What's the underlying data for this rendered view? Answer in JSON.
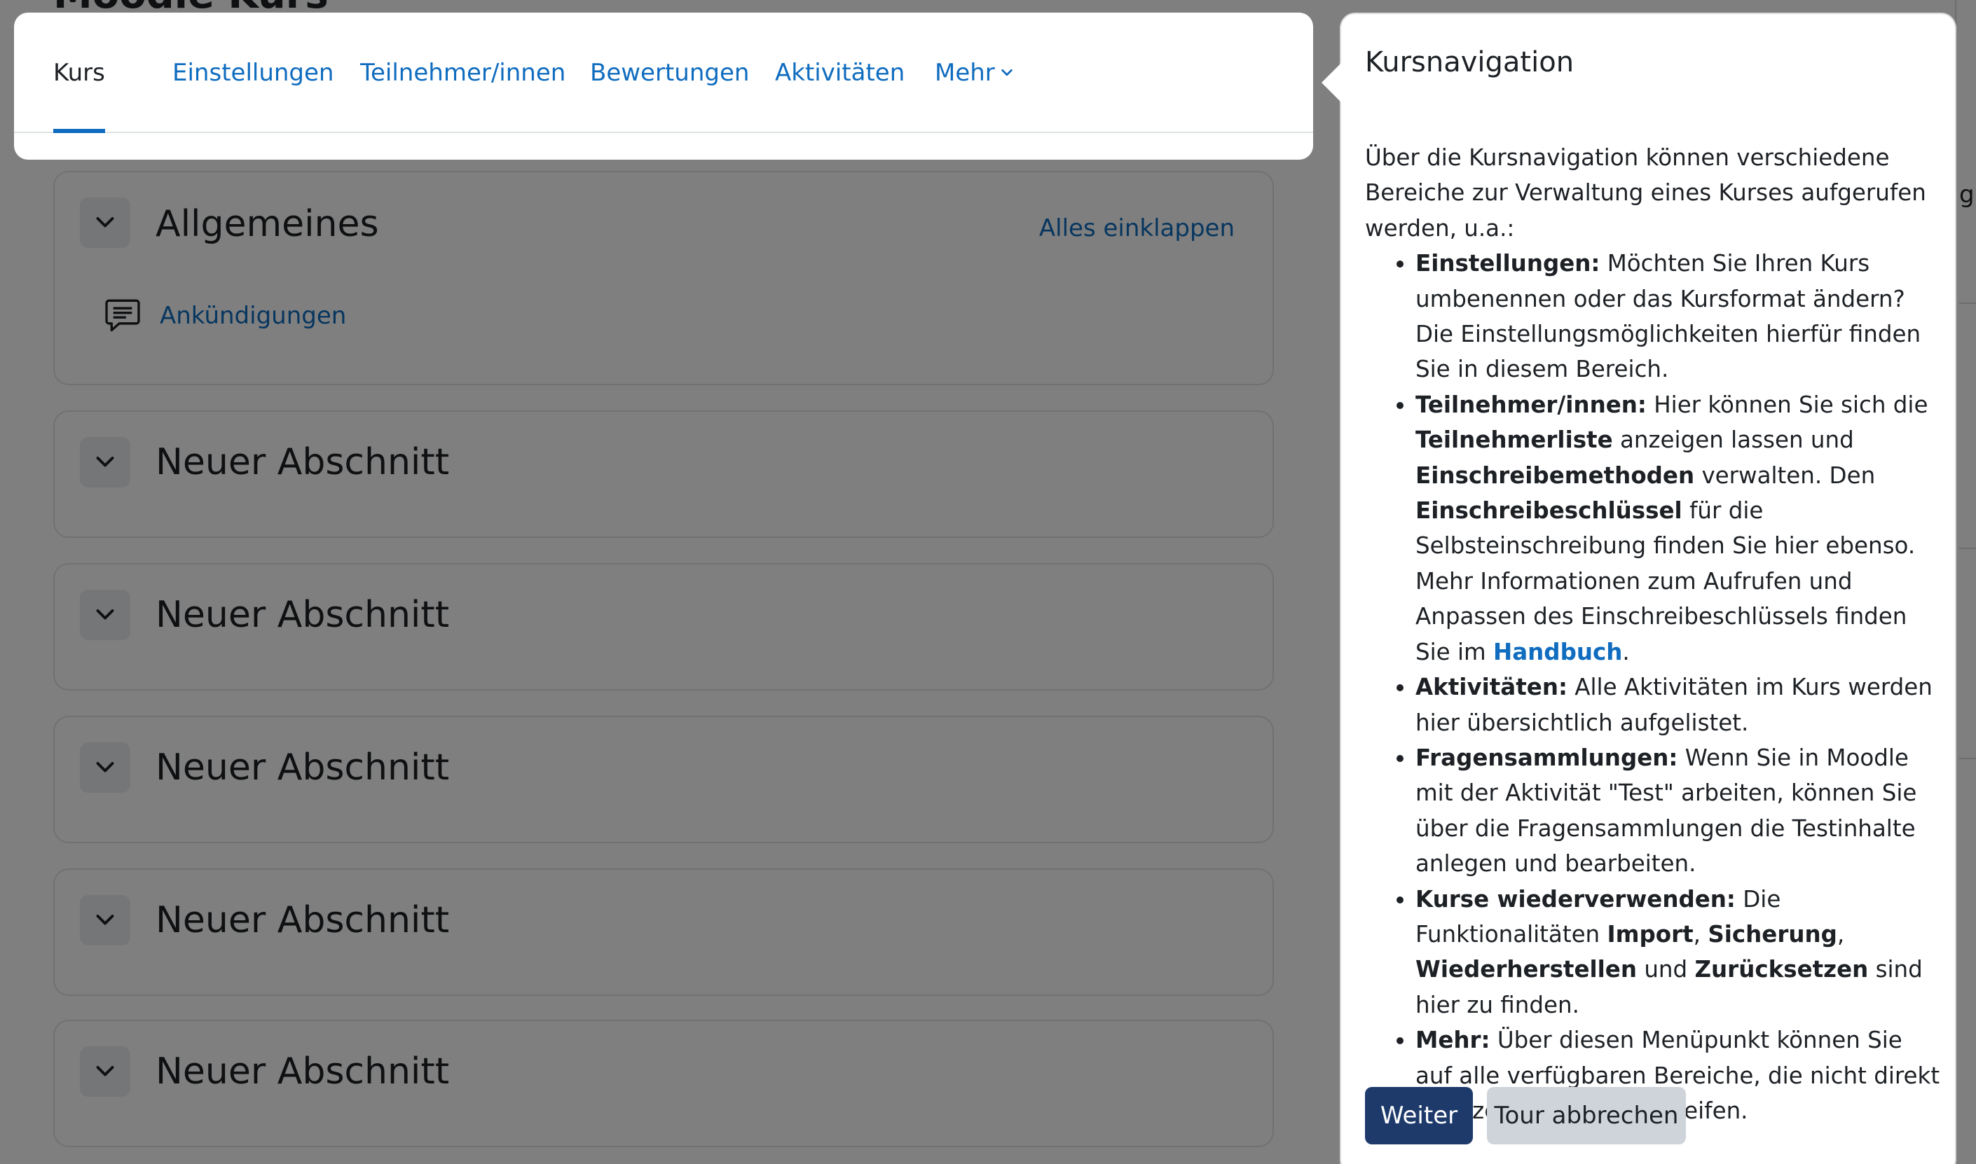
{
  "page": {
    "title": "Moodle Kurs"
  },
  "sections": [
    {
      "title": "Allgemeines",
      "collapse_all": "Alles einklappen",
      "activities": [
        {
          "label": "Ankündigungen",
          "icon": "forum-icon"
        }
      ]
    },
    {
      "title": "Neuer Abschnitt"
    },
    {
      "title": "Neuer Abschnitt"
    },
    {
      "title": "Neuer Abschnitt"
    },
    {
      "title": "Neuer Abschnitt"
    },
    {
      "title": "Neuer Abschnitt"
    }
  ],
  "secondary_nav": {
    "tabs": [
      "Kurs",
      "Einstellungen",
      "Teilnehmer/innen",
      "Bewertungen",
      "Aktivitäten",
      "Mehr"
    ],
    "active": "Kurs",
    "more_icon": "chevron-down-icon"
  },
  "tour": {
    "title": "Kursnavigation",
    "intro": "Über die Kursnavigation können verschiedene Bereiche zur Verwaltung eines Kurses aufgerufen werden, u.a.:",
    "items": [
      {
        "term": "Einstellungen:",
        "text": "Möchten Sie Ihren Kurs umbenennen oder das Kursformat ändern? Die Einstellungsmöglichkeiten hierfür finden Sie in diesem Bereich."
      },
      {
        "term": "Teilnehmer/innen:",
        "text_1": "Hier können Sie sich die",
        "bold_1": "Teilnehmerliste",
        "text_2": "anzeigen lassen und",
        "bold_2": "Einschreibemethoden",
        "text_3": "verwalten. Den",
        "bold_3": "Einschreibeschlüssel",
        "text_4": "für die Selbsteinschreibung finden Sie hier ebenso. Mehr Informationen zum Aufrufen und Anpassen des Einschreibeschlüssels finden Sie im",
        "link": "Handbuch",
        "text_5": "."
      },
      {
        "term": "Aktivitäten:",
        "text": "Alle Aktivitäten im Kurs werden hier übersichtlich aufgelistet."
      },
      {
        "term": "Fragensammlungen:",
        "text": "Wenn Sie in Moodle mit der Aktivität \"Test\" arbeiten, können Sie über die Fragensammlungen die Testinhalte anlegen und bearbeiten."
      },
      {
        "term": "Kurse wiederverwenden:",
        "text_1": "Die Funktionalitäten",
        "bold_1": "Import",
        "sep_1": ",",
        "bold_2": "Sicherung",
        "sep_2": ",",
        "bold_3": "Wiederherstellen",
        "text_2": "und",
        "bold_4": "Zurücksetzen",
        "text_3": "sind hier zu finden."
      },
      {
        "term": "Mehr:",
        "text": "Über diesen Menüpunkt können Sie auf alle verfügbaren Bereiche, die nicht direkt angezeigt werden, zugreifen."
      }
    ],
    "next_label": "Weiter",
    "end_label": "Tour abbrechen"
  },
  "colors": {
    "link": "#0f6cbf",
    "primary_button": "#1e3a6b",
    "secondary_button": "#ced4da",
    "backdrop": "rgba(0,0,0,0.5)"
  }
}
